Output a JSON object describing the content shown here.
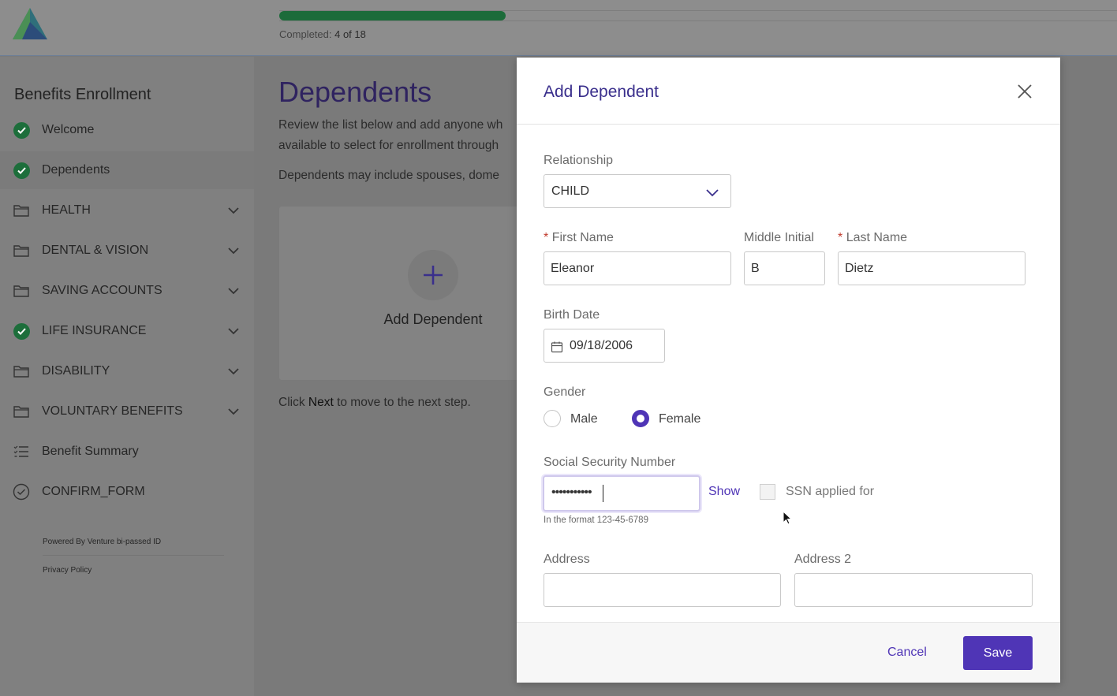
{
  "progress": {
    "completed_label": "Completed:",
    "completed_value": "4 of 18",
    "fraction": 0.27
  },
  "sidebar": {
    "title": "Benefits Enrollment",
    "items": [
      {
        "label": "Welcome",
        "icon": "check-circle-icon",
        "status": "complete"
      },
      {
        "label": "Dependents",
        "icon": "check-circle-icon",
        "status": "complete",
        "active": true
      },
      {
        "label": "HEALTH",
        "icon": "folder-icon",
        "expandable": true
      },
      {
        "label": "DENTAL & VISION",
        "icon": "folder-icon",
        "expandable": true
      },
      {
        "label": "SAVING ACCOUNTS",
        "icon": "folder-icon",
        "expandable": true
      },
      {
        "label": "LIFE INSURANCE",
        "icon": "check-circle-icon",
        "status": "complete",
        "expandable": true
      },
      {
        "label": "DISABILITY",
        "icon": "folder-icon",
        "expandable": true
      },
      {
        "label": "VOLUNTARY BENEFITS",
        "icon": "folder-icon",
        "expandable": true
      },
      {
        "label": "Benefit Summary",
        "icon": "list-icon"
      },
      {
        "label": "CONFIRM_FORM",
        "icon": "check-outline-icon"
      }
    ],
    "footer": {
      "powered_by": "Powered By Venture  bi-passed ID",
      "privacy": "Privacy Policy"
    }
  },
  "main": {
    "title": "Dependents",
    "para1_line1": "Review the list below and add anyone wh",
    "para1_line2": "available to select for enrollment through",
    "para2": "Dependents may include spouses, dome",
    "add_card_label": "Add Dependent",
    "next_hint_before": "Click ",
    "next_hint_bold": "Next",
    "next_hint_after": " to move to the next step."
  },
  "modal": {
    "title": "Add Dependent",
    "relationship": {
      "label": "Relationship",
      "value": "CHILD"
    },
    "first_name": {
      "label": "First Name",
      "value": "Eleanor",
      "required": true
    },
    "middle_initial": {
      "label": "Middle Initial",
      "value": "B"
    },
    "last_name": {
      "label": "Last Name",
      "value": "Dietz",
      "required": true
    },
    "birth_date": {
      "label": "Birth Date",
      "value": "09/18/2006"
    },
    "gender": {
      "label": "Gender",
      "options": [
        "Male",
        "Female"
      ],
      "selected": "Female"
    },
    "ssn": {
      "label": "Social Security Number",
      "value": "•••••••••••",
      "show_label": "Show",
      "applied_label": "SSN applied for",
      "hint": "In the format 123-45-6789"
    },
    "address": {
      "label": "Address",
      "value": ""
    },
    "address2": {
      "label": "Address 2",
      "value": ""
    },
    "cancel_label": "Cancel",
    "save_label": "Save"
  },
  "colors": {
    "accent": "#4f35b6",
    "success": "#1d6e3b",
    "title": "#3a2f8c"
  }
}
